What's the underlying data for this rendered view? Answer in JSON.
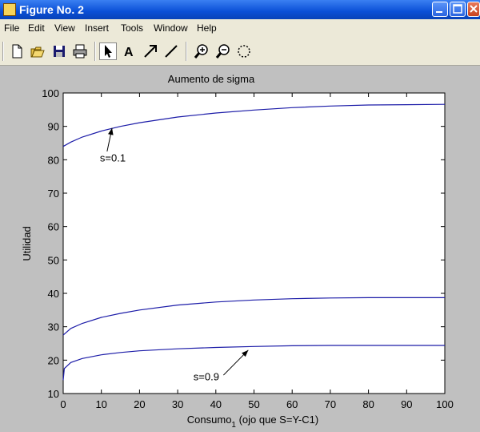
{
  "window": {
    "title": "Figure No. 2"
  },
  "menu": [
    "File",
    "Edit",
    "View",
    "Insert",
    "Tools",
    "Window",
    "Help"
  ],
  "toolbar": {
    "buttons": [
      "new-file",
      "open-file",
      "save",
      "print",
      "select-arrow",
      "insert-text",
      "insert-arrow",
      "insert-line",
      "zoom-in",
      "zoom-out",
      "rotate-3d"
    ],
    "selected": "select-arrow",
    "text_tool_label": "A"
  },
  "chart_data": {
    "type": "line",
    "title": "Aumento de sigma",
    "xlabel_main": "Consumo",
    "xlabel_sub": "1",
    "xlabel_rest": " (ojo que S=Y-C1)",
    "ylabel": "Utilidad",
    "xlim": [
      0,
      100
    ],
    "ylim": [
      10,
      100
    ],
    "xticks": [
      0,
      10,
      20,
      30,
      40,
      50,
      60,
      70,
      80,
      90,
      100
    ],
    "yticks": [
      10,
      20,
      30,
      40,
      50,
      60,
      70,
      80,
      90,
      100
    ],
    "grid": false,
    "line_color": "#1c1ca8",
    "series": [
      {
        "x": [
          0,
          2,
          5,
          10,
          15,
          20,
          30,
          40,
          50,
          60,
          70,
          80,
          90,
          100
        ],
        "y": [
          84,
          85.3,
          86.8,
          88.6,
          90,
          91.1,
          92.8,
          94,
          94.9,
          95.6,
          96.1,
          96.4,
          96.5,
          96.6
        ]
      },
      {
        "x": [
          0,
          2,
          5,
          10,
          15,
          20,
          30,
          40,
          50,
          60,
          70,
          80,
          90,
          100
        ],
        "y": [
          27.5,
          29.5,
          31,
          32.8,
          34,
          35,
          36.5,
          37.4,
          38,
          38.4,
          38.6,
          38.7,
          38.7,
          38.7
        ]
      },
      {
        "x": [
          0,
          0.3,
          2,
          5,
          10,
          15,
          20,
          30,
          40,
          50,
          60,
          70,
          80,
          90,
          100
        ],
        "y": [
          14,
          17.5,
          19.3,
          20.5,
          21.6,
          22.3,
          22.8,
          23.4,
          23.8,
          24.1,
          24.3,
          24.4,
          24.4,
          24.4,
          24.4
        ]
      }
    ],
    "annotations": [
      {
        "text": "s=0.1",
        "text_x": 13,
        "text_y": 79.5,
        "arrow_from": [
          11.5,
          82.5
        ],
        "arrow_to": [
          12.8,
          89.5
        ]
      },
      {
        "text": "s=0.9",
        "text_x": 37.5,
        "text_y": 14,
        "arrow_from": [
          42,
          15.5
        ],
        "arrow_to": [
          48.5,
          23
        ]
      }
    ]
  }
}
